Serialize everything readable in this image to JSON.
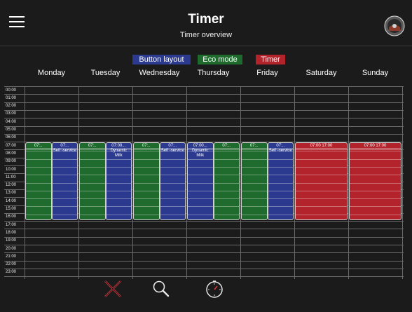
{
  "header": {
    "title": "Timer",
    "subtitle": "Timer overview"
  },
  "legend": [
    {
      "label": "Button layout",
      "color": "#2b3a8f"
    },
    {
      "label": "Eco mode",
      "color": "#1f6b2d"
    },
    {
      "label": "Timer",
      "color": "#b3232b"
    }
  ],
  "days": [
    "Monday",
    "Tuesday",
    "Wednesday",
    "Thursday",
    "Friday",
    "Saturday",
    "Sunday"
  ],
  "hours": [
    "00:00",
    "01:00",
    "02:00",
    "03:00",
    "04:00",
    "05:00",
    "06:00",
    "07:00",
    "08:00",
    "09:00",
    "10:00",
    "11:00",
    "12:00",
    "13:00",
    "14:00",
    "15:00",
    "16:00",
    "17:00",
    "18:00",
    "19:00",
    "20:00",
    "21:00",
    "22:00",
    "23:00"
  ],
  "blocks": [
    {
      "day": 0,
      "half": "left",
      "type": "eco",
      "time": "07:..",
      "sub": ""
    },
    {
      "day": 0,
      "half": "right",
      "type": "button",
      "time": "07:..",
      "sub": "Self -service"
    },
    {
      "day": 1,
      "half": "left",
      "type": "eco",
      "time": "07:..",
      "sub": ""
    },
    {
      "day": 1,
      "half": "right",
      "type": "button",
      "time": "07:00...",
      "sub": "Dynamic Milk"
    },
    {
      "day": 2,
      "half": "left",
      "type": "eco",
      "time": "07:..",
      "sub": ""
    },
    {
      "day": 2,
      "half": "right",
      "type": "button",
      "time": "07:..",
      "sub": "Self -service"
    },
    {
      "day": 3,
      "half": "left",
      "type": "button",
      "time": "07:00...",
      "sub": "Dynamic Milk"
    },
    {
      "day": 3,
      "half": "right",
      "type": "eco",
      "time": "07:..",
      "sub": ""
    },
    {
      "day": 4,
      "half": "left",
      "type": "eco",
      "time": "07:..",
      "sub": ""
    },
    {
      "day": 4,
      "half": "right",
      "type": "button",
      "time": "07:..",
      "sub": "Self -service"
    },
    {
      "day": 5,
      "half": "full",
      "type": "timer",
      "time": "07:00  17:00",
      "sub": ""
    },
    {
      "day": 6,
      "half": "full",
      "type": "timer",
      "time": "07:00  17:00",
      "sub": ""
    }
  ],
  "colors": {
    "eco": "#1f6b2d",
    "button": "#2b3a8f",
    "timer": "#b3232b",
    "accent_red": "#d9363e"
  },
  "icons": {
    "cancel": "close-x-icon",
    "search": "magnifier-icon",
    "timer": "stopwatch-icon"
  }
}
